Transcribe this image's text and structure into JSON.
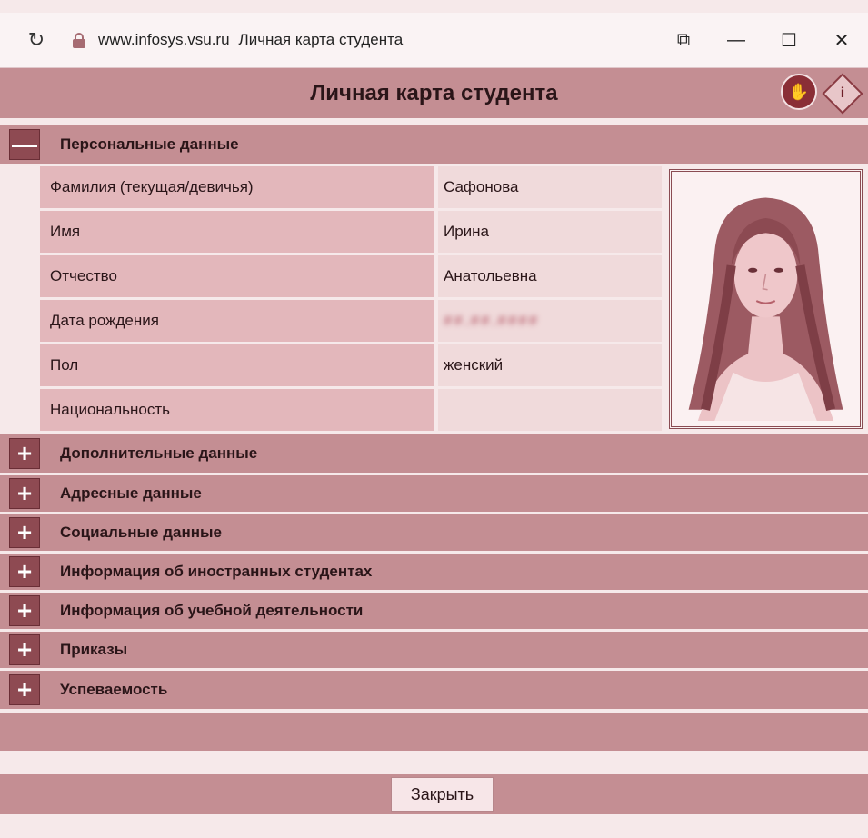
{
  "browser": {
    "url": "www.infosys.vsu.ru",
    "tab_title": "Личная карта студента"
  },
  "page": {
    "title": "Личная карта студента"
  },
  "personal": {
    "section_label": "Персональные данные",
    "rows": [
      {
        "label": "Фамилия (текущая/девичья)",
        "value": "Сафонова"
      },
      {
        "label": "Имя",
        "value": "Ирина"
      },
      {
        "label": "Отчество",
        "value": "Анатольевна"
      },
      {
        "label": "Дата рождения",
        "value": "##.##.####"
      },
      {
        "label": "Пол",
        "value": "женский"
      },
      {
        "label": "Национальность",
        "value": ""
      }
    ]
  },
  "sections": [
    "Дополнительные данные",
    "Адресные данные",
    "Социальные данные",
    "Информация об иностранных студентах",
    "Информация об учебной деятельности",
    "Приказы",
    "Успеваемость"
  ],
  "footer": {
    "close_label": "Закрыть"
  },
  "colors": {
    "header": "#c48e93",
    "label_cell": "#e3b7bb",
    "value_cell": "#f0dadb",
    "toggle": "#8e4a52"
  }
}
